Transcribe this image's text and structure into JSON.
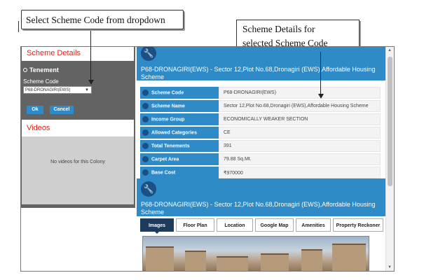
{
  "callouts": {
    "left": "Select Scheme Code from dropdown",
    "right_line1": "Scheme Details for",
    "right_line2": "selected Scheme Code"
  },
  "left_panel": {
    "scheme_details_heading": "Scheme Details",
    "radio_label": "Tenement",
    "scheme_code_label": "Scheme Code",
    "scheme_code_selected": "P68-DRONAGIRI(EWS)",
    "ok_label": "Ok",
    "cancel_label": "Cancel",
    "videos_heading": "Videos",
    "videos_empty_text": "No videos for this Colony"
  },
  "scheme": {
    "title": "P68-DRONAGIRI(EWS) - Sector 12,Plot No.68,Dronagiri (EWS),Affordable Housing Scheme",
    "rows": [
      {
        "label": "Scheme Code",
        "value": "P68-DRONAGIRI(EWS)"
      },
      {
        "label": "Scheme Name",
        "value": "Sector 12,Plot No.68,Dronagiri (EWS),Affordable Housing Scheme"
      },
      {
        "label": "Income Group",
        "value": "ECONOMICALLY WEAKER SECTION"
      },
      {
        "label": "Allowed Categories",
        "value": "CE"
      },
      {
        "label": "Total Tenements",
        "value": "391"
      },
      {
        "label": "Carpet Area",
        "value": "79.88 Sq.Mt."
      },
      {
        "label": "Base Cost",
        "value": "₹970000"
      }
    ]
  },
  "gallery": {
    "title": "P68-DRONAGIRI(EWS) - Sector 12,Plot No.68,Dronagiri (EWS),Affordable Housing Scheme",
    "tabs": [
      "Images",
      "Floor Plan",
      "Location",
      "Google Map",
      "Amenities",
      "Property Reckoner"
    ],
    "active_tab": "Images"
  },
  "icons": {
    "header_icon": "wrench-icon",
    "row_bullet": "wrench-bullet-icon"
  },
  "colors": {
    "accent_blue": "#2f8ac8",
    "heading_red": "#d9261c",
    "panel_gray": "#636363",
    "active_tab": "#1f3b5c"
  }
}
